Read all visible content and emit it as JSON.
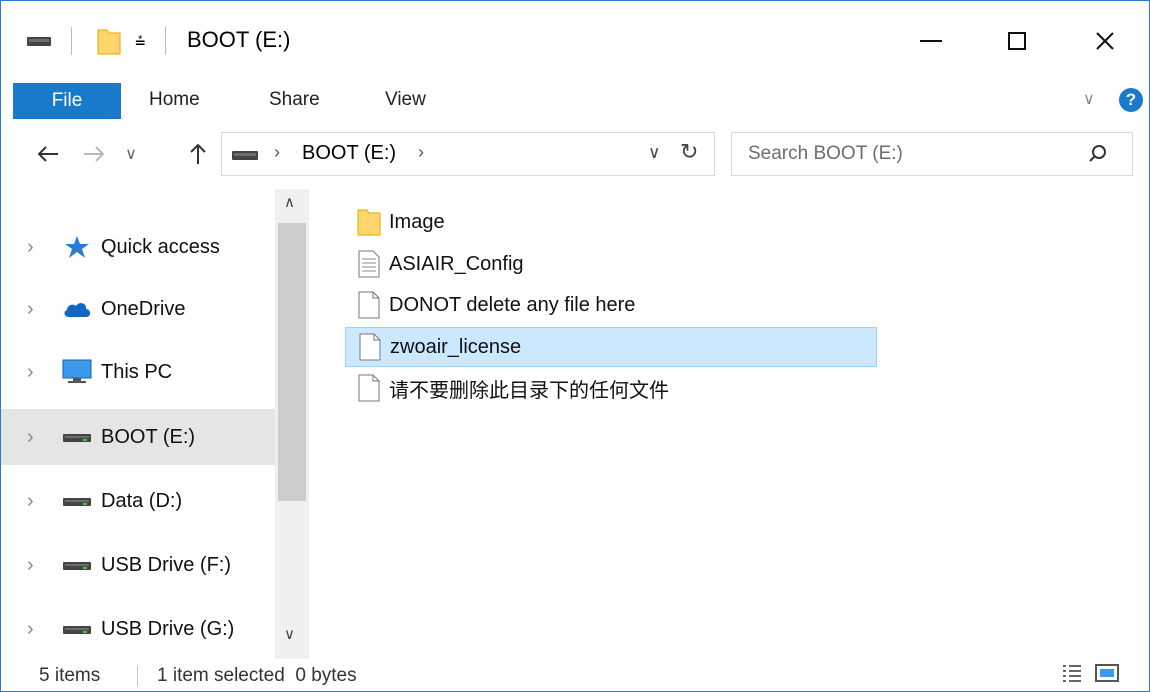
{
  "window": {
    "title": "BOOT (E:)"
  },
  "ribbon": {
    "tabs": [
      "File",
      "Home",
      "Share",
      "View"
    ]
  },
  "address": {
    "path": [
      "BOOT (E:)"
    ]
  },
  "search": {
    "placeholder": "Search BOOT (E:)"
  },
  "nav_pane": {
    "items": [
      {
        "label": "Quick access",
        "icon": "star-icon"
      },
      {
        "label": "OneDrive",
        "icon": "cloud-icon"
      },
      {
        "label": "This PC",
        "icon": "computer-icon"
      },
      {
        "label": "BOOT (E:)",
        "icon": "drive-icon",
        "selected": true
      },
      {
        "label": "Data (D:)",
        "icon": "drive-icon"
      },
      {
        "label": "USB Drive (F:)",
        "icon": "drive-icon"
      },
      {
        "label": "USB Drive (G:)",
        "icon": "drive-icon"
      }
    ]
  },
  "files": [
    {
      "name": "Image",
      "type": "folder"
    },
    {
      "name": "ASIAIR_Config",
      "type": "text-file"
    },
    {
      "name": "DONOT delete any file here",
      "type": "file"
    },
    {
      "name": "zwoair_license",
      "type": "file",
      "selected": true
    },
    {
      "name": "请不要删除此目录下的任何文件",
      "type": "file"
    }
  ],
  "status": {
    "count": "5 items",
    "selection": "1 item selected  0 bytes"
  },
  "colors": {
    "accent": "#1979ca",
    "selection": "#cce8ff",
    "folder": "#ffd66b"
  }
}
